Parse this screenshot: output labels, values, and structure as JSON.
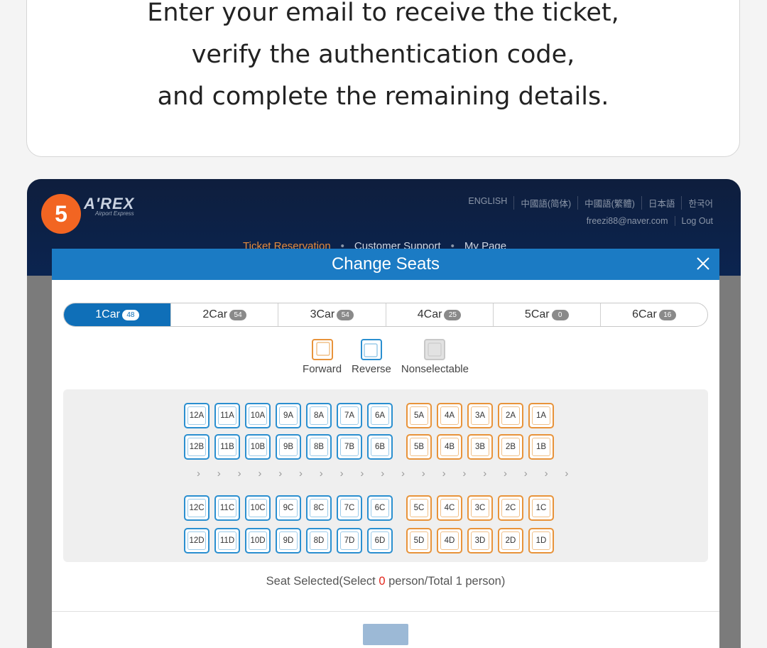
{
  "instructions": {
    "lines": [
      "Enter your email to receive the ticket,",
      "verify the authentication code,",
      "and complete the remaining details."
    ]
  },
  "step_badge": "5",
  "site": {
    "logo": "A'REX",
    "logo_sub": "Airport Express",
    "languages": [
      "ENGLISH",
      "中國語(简体)",
      "中國語(繁體)",
      "日本語",
      "한국어"
    ],
    "user_email": "freezi88@naver.com",
    "logout": "Log Out",
    "nav": [
      "Ticket Reservation",
      "Customer Support",
      "My Page"
    ],
    "nav_active_index": 0,
    "header_color": "#0b2450",
    "accent": "#1b7bc4"
  },
  "modal": {
    "title": "Change Seats",
    "close_icon": "close-icon",
    "cars": [
      {
        "label": "1Car",
        "count": "48",
        "active": true
      },
      {
        "label": "2Car",
        "count": "54",
        "active": false
      },
      {
        "label": "3Car",
        "count": "54",
        "active": false
      },
      {
        "label": "4Car",
        "count": "25",
        "active": false
      },
      {
        "label": "5Car",
        "count": "0",
        "active": false
      },
      {
        "label": "6Car",
        "count": "16",
        "active": false
      }
    ],
    "legend": [
      {
        "label": "Forward",
        "color": "#e8933a"
      },
      {
        "label": "Reverse",
        "color": "#2a8fd0"
      },
      {
        "label": "Nonselectable",
        "color": "#cccccc"
      }
    ],
    "seat_rows": [
      {
        "row": "A",
        "reverse": [
          "12A",
          "11A",
          "10A",
          "9A",
          "8A",
          "7A",
          "6A"
        ],
        "forward": [
          "5A",
          "4A",
          "3A",
          "2A",
          "1A"
        ]
      },
      {
        "row": "B",
        "reverse": [
          "12B",
          "11B",
          "10B",
          "9B",
          "8B",
          "7B",
          "6B"
        ],
        "forward": [
          "5B",
          "4B",
          "3B",
          "2B",
          "1B"
        ]
      },
      {
        "row": "C",
        "reverse": [
          "12C",
          "11C",
          "10C",
          "9C",
          "8C",
          "7C",
          "6C"
        ],
        "forward": [
          "5C",
          "4C",
          "3C",
          "2C",
          "1C"
        ]
      },
      {
        "row": "D",
        "reverse": [
          "12D",
          "11D",
          "10D",
          "9D",
          "8D",
          "7D",
          "6D"
        ],
        "forward": [
          "5D",
          "4D",
          "3D",
          "2D",
          "1D"
        ]
      }
    ],
    "aisle_arrow": "›",
    "aisle_arrow_count": 19,
    "status": {
      "prefix": "Seat Selected(Select ",
      "selected": "0",
      "suffix": " person/Total 1 person)"
    }
  }
}
